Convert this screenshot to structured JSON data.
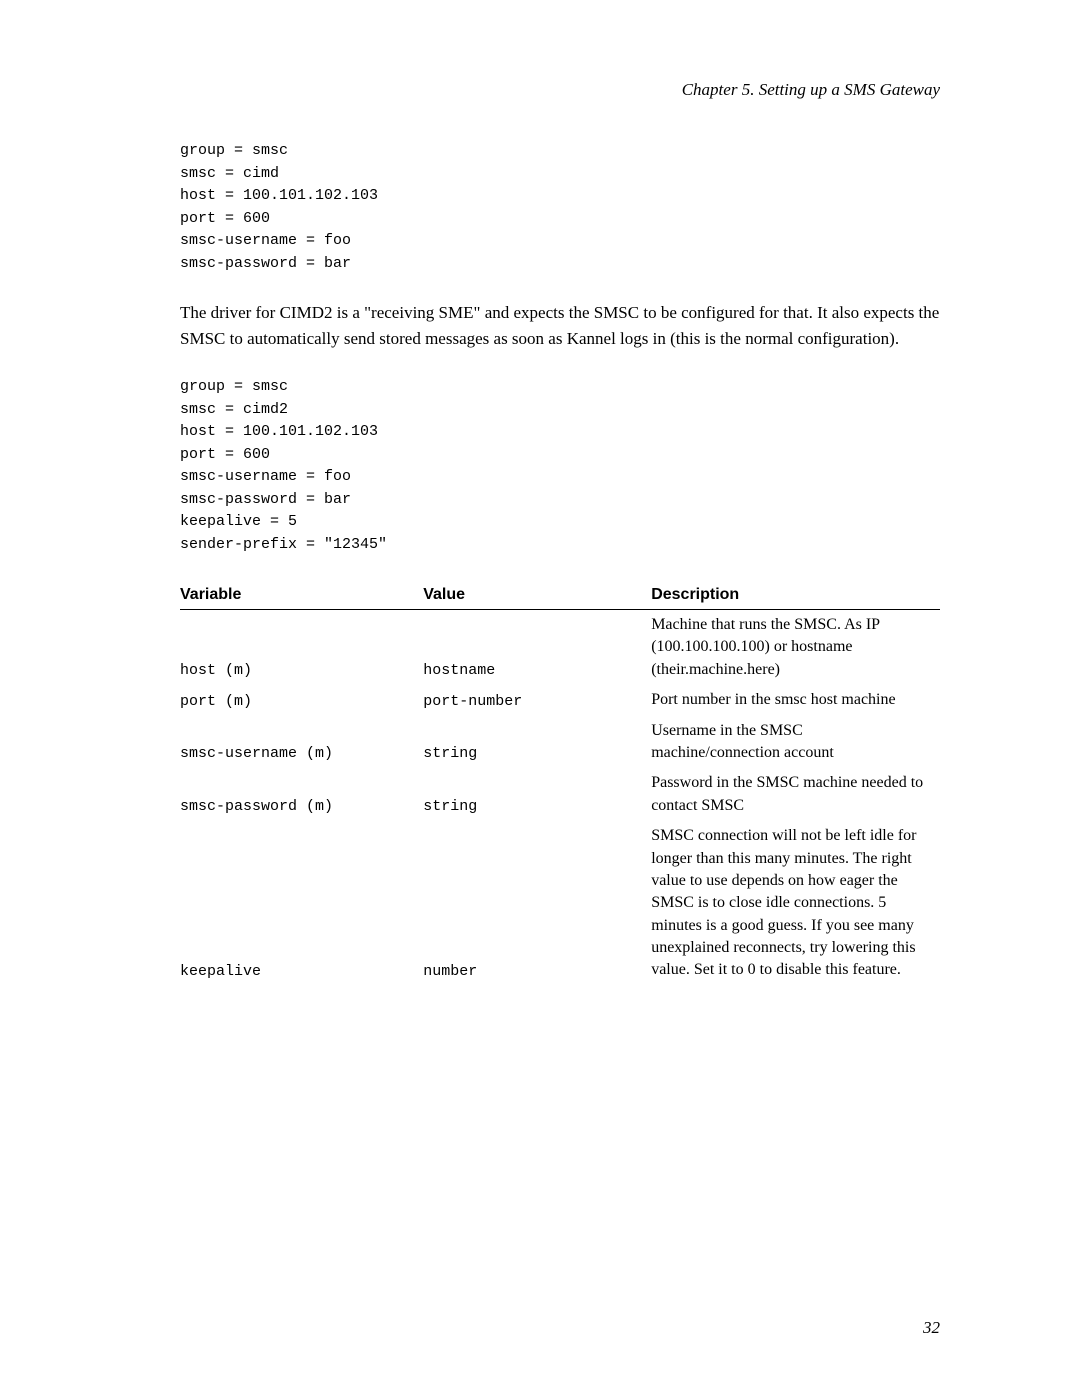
{
  "chapter_header": "Chapter 5. Setting up a SMS Gateway",
  "code1": "group = smsc\nsmsc = cimd\nhost = 100.101.102.103\nport = 600\nsmsc-username = foo\nsmsc-password = bar",
  "para1": "The driver for CIMD2 is a \"receiving SME\" and expects the SMSC to be configured for that. It also expects the SMSC to automatically send stored messages as soon as Kannel logs in (this is the normal configuration).",
  "code2": "group = smsc\nsmsc = cimd2\nhost = 100.101.102.103\nport = 600\nsmsc-username = foo\nsmsc-password = bar\nkeepalive = 5\nsender-prefix = \"12345\"",
  "table": {
    "headers": {
      "variable": "Variable",
      "value": "Value",
      "description": "Description"
    },
    "rows": [
      {
        "variable": "host (m)",
        "value": "hostname",
        "description": "Machine that runs the SMSC. As IP (100.100.100.100) or hostname (their.machine.here)"
      },
      {
        "variable": "port (m)",
        "value": "port-number",
        "description": "Port number in the smsc host machine"
      },
      {
        "variable": "smsc-username (m)",
        "value": "string",
        "description": "Username in the SMSC machine/connection account"
      },
      {
        "variable": "smsc-password (m)",
        "value": "string",
        "description": "Password in the SMSC machine needed to contact SMSC"
      },
      {
        "variable": "keepalive",
        "value": "number",
        "description": "SMSC connection will not be left idle for longer than this many minutes. The right value to use depends on how eager the SMSC is to close idle connections. 5 minutes is a good guess. If you see many unexplained reconnects, try lowering this value. Set it to 0 to disable this feature."
      }
    ]
  },
  "page_number": "32"
}
